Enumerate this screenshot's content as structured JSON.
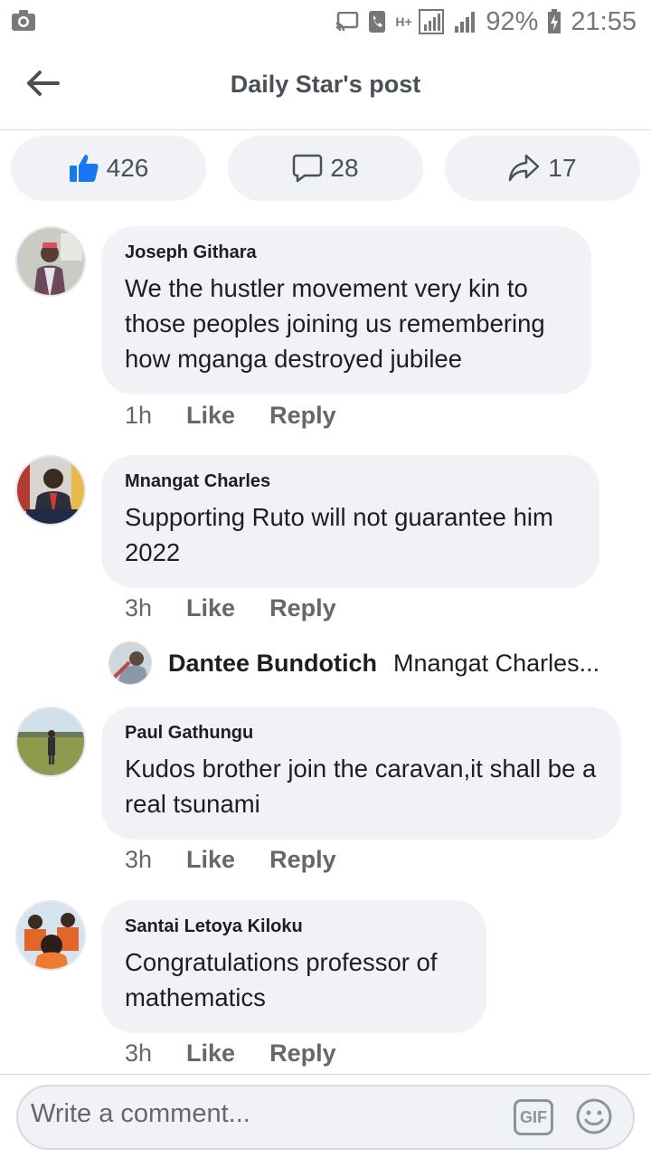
{
  "status_bar": {
    "battery": "92%",
    "time": "21:55",
    "network": "H+"
  },
  "header": {
    "title": "Daily Star's post"
  },
  "reactions": {
    "likes": "426",
    "comments": "28",
    "shares": "17"
  },
  "comments": [
    {
      "name": "Joseph Githara",
      "text": "We the hustler movement  very kin to those peoples joining us remembering how mganga  destroyed jubilee",
      "time": "1h",
      "like": "Like",
      "reply": "Reply"
    },
    {
      "name": "Mnangat Charles",
      "text": "Supporting Ruto will not guarantee him 2022",
      "time": "3h",
      "like": "Like",
      "reply": "Reply"
    },
    {
      "name": "Paul Gathungu",
      "text": "Kudos brother join the caravan,it shall be a real tsunami",
      "time": "3h",
      "like": "Like",
      "reply": "Reply"
    },
    {
      "name": "Santai Letoya Kiloku",
      "text": "Congratulations professor of mathematics",
      "time": "3h",
      "like": "Like",
      "reply": "Reply"
    }
  ],
  "reply_preview": {
    "name": "Dantee Bundotich",
    "text": "Mnangat Charles..."
  },
  "composer": {
    "placeholder": "Write a comment...",
    "gif_label": "GIF"
  },
  "colors": {
    "like_blue": "#1877f2",
    "bubble": "#f0f2f5",
    "meta_gray": "#65676b"
  }
}
